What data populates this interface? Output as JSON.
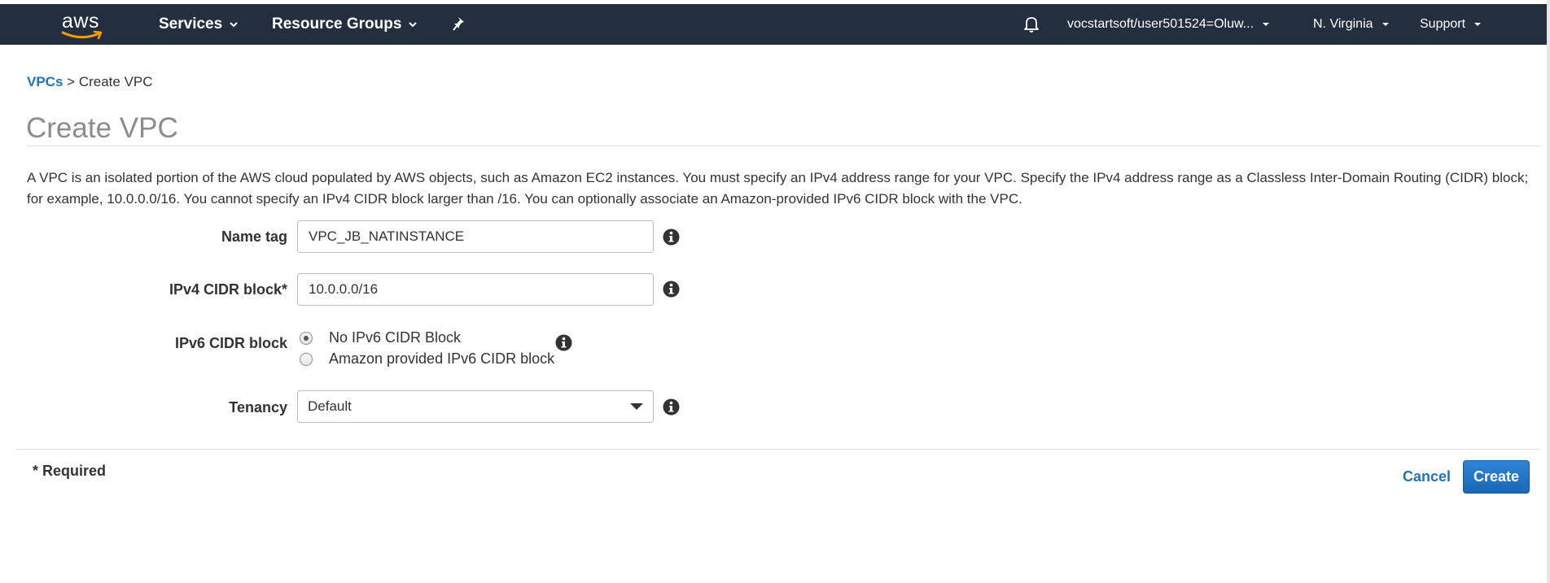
{
  "nav": {
    "logo_text": "aws",
    "services_label": "Services",
    "resource_groups_label": "Resource Groups",
    "account_label": "vocstartsoft/user501524=Oluw...",
    "region_label": "N. Virginia",
    "support_label": "Support",
    "background_color": "#232f3e",
    "logo_accent_color": "#ff9900"
  },
  "breadcrumb": {
    "parent_label": "VPCs",
    "separator": ">",
    "current_label": "Create VPC"
  },
  "page": {
    "title": "Create VPC",
    "description": "A VPC is an isolated portion of the AWS cloud populated by AWS objects, such as Amazon EC2 instances. You must specify an IPv4 address range for your VPC. Specify the IPv4 address range as a Classless Inter-Domain Routing (CIDR) block; for example, 10.0.0.0/16. You cannot specify an IPv4 CIDR block larger than /16. You can optionally associate an Amazon-provided IPv6 CIDR block with the VPC."
  },
  "form": {
    "name_tag": {
      "label": "Name tag",
      "value": "VPC_JB_NATINSTANCE"
    },
    "ipv4_cidr": {
      "label": "IPv4 CIDR block*",
      "value": "10.0.0.0/16"
    },
    "ipv6_cidr": {
      "label": "IPv6 CIDR block",
      "options": [
        {
          "label": "No IPv6 CIDR Block",
          "selected": true
        },
        {
          "label": "Amazon provided IPv6 CIDR block",
          "selected": false
        }
      ]
    },
    "tenancy": {
      "label": "Tenancy",
      "selected": "Default"
    }
  },
  "footer": {
    "required_note": "* Required",
    "cancel_label": "Cancel",
    "create_label": "Create",
    "primary_color": "#1f73b7"
  },
  "icons": {
    "info": "info-icon",
    "bell": "bell-icon",
    "pin": "pin-icon",
    "caret": "chevron-down-icon"
  }
}
